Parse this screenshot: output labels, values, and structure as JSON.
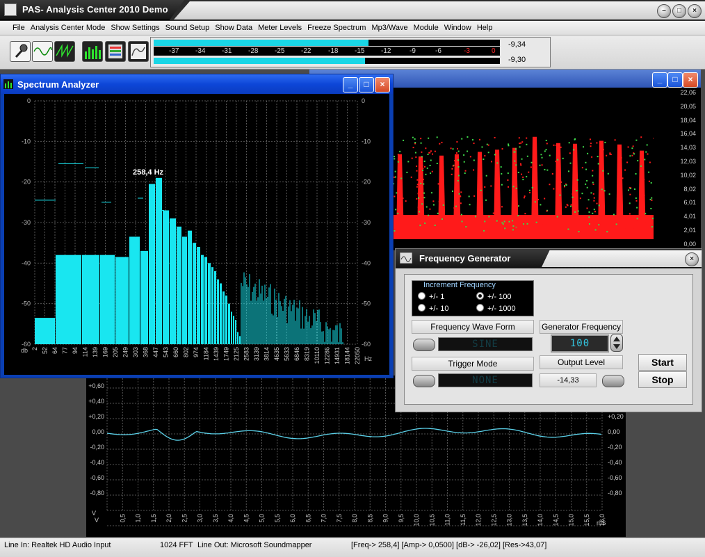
{
  "app": {
    "title": "PAS- Analysis Center 2010 Demo"
  },
  "menu": [
    "File",
    "Analysis Center Mode",
    "Show Settings",
    "Sound Setup",
    "Show Data",
    "Meter Levels",
    "Freeze Spectrum",
    "Mp3/Wave",
    "Module",
    "Window",
    "Help"
  ],
  "toolbar": {
    "tools": [
      "microphone-icon",
      "sine-wave-icon",
      "sawtooth-wave-icon",
      "spectrum-icon",
      "data-icon",
      "envelope-icon"
    ]
  },
  "meter": {
    "scale": [
      "-37",
      "-34",
      "-31",
      "-28",
      "-25",
      "-22",
      "-18",
      "-15",
      "-12",
      "-9",
      "-6",
      "-3",
      "0"
    ],
    "left_level": 0.62,
    "right_level": 0.61,
    "left_value": "-9,34",
    "right_value": "-9,30"
  },
  "spectrum_analyzer": {
    "title": "Spectrum Analyzer",
    "peak_label": "258,4 Hz",
    "y_ticks": [
      "0",
      "-10",
      "-20",
      "-30",
      "-40",
      "-50",
      "-60"
    ],
    "y_unit": "db",
    "x_ticks": [
      "2",
      "52",
      "64",
      "77",
      "94",
      "114",
      "139",
      "169",
      "205",
      "249",
      "303",
      "368",
      "447",
      "543",
      "660",
      "802",
      "974",
      "1184",
      "1439",
      "1749",
      "2125",
      "2583",
      "3139",
      "3814",
      "4635",
      "5633",
      "6846",
      "8319",
      "10110",
      "12286",
      "14931",
      "18144",
      "22050"
    ],
    "x_unit": "Hz"
  },
  "spectrogram": {
    "y_ticks": [
      "22,06",
      "20,05",
      "18,04",
      "16,04",
      "14,03",
      "12,03",
      "10,02",
      "8,02",
      "6,01",
      "4,01",
      "2,01",
      "0,00"
    ]
  },
  "oscilloscope": {
    "y_ticks_left": [
      "+0,60",
      "+0,40",
      "+0,20",
      "0,00",
      "-0,20",
      "-0,40",
      "-0,60",
      "-0,80"
    ],
    "y_ticks_right": [
      "+0,20",
      "0,00",
      "-0,20",
      "-0,40",
      "-0,60",
      "-0,80"
    ],
    "x_ticks": [
      "0,5",
      "1,0",
      "1,5",
      "2,0",
      "2,5",
      "3,0",
      "3,5",
      "4,0",
      "4,5",
      "5,0",
      "5,5",
      "6,0",
      "6,5",
      "7,0",
      "7,5",
      "8,0",
      "8,5",
      "9,0",
      "9,5",
      "10,0",
      "10,5",
      "11,0",
      "11,5",
      "12,0",
      "12,5",
      "13,0",
      "13,5",
      "14,0",
      "14,5",
      "15,0",
      "15,5",
      "16,0"
    ],
    "x_unit": "mS",
    "y_unit": "V"
  },
  "frequency_generator": {
    "title": "Frequency Generator",
    "increment_label": "Increment Frequency",
    "options": [
      "+/- 1",
      "+/- 100",
      "+/- 10",
      "+/- 1000"
    ],
    "selected": "+/- 100",
    "wave_form_label": "Frequency Wave Form",
    "wave_form_value": "SINE",
    "generator_frequency_label": "Generator Frequency",
    "generator_frequency_value": "100",
    "trigger_mode_label": "Trigger Mode",
    "trigger_mode_value": "NONE",
    "output_level_label": "Output Level",
    "output_level_value": "-14,33",
    "start_label": "Start",
    "stop_label": "Stop"
  },
  "status": {
    "line_in": "Line In: Realtek HD Audio Input",
    "fft": "1024 FFT",
    "line_out": "Line Out: Microsoft Soundmapper",
    "readout": "[Freq-> 258,4]  [Amp-> 0,0500]  [dB-> -26,02]  [Res->43,07]"
  },
  "colors": {
    "spectrum_bar": "#19e6f0",
    "spectrogram_hot": "#ff1a1a",
    "spectrogram_cool": "#3fd94a",
    "scope_trace": "#5bd0e8"
  }
}
